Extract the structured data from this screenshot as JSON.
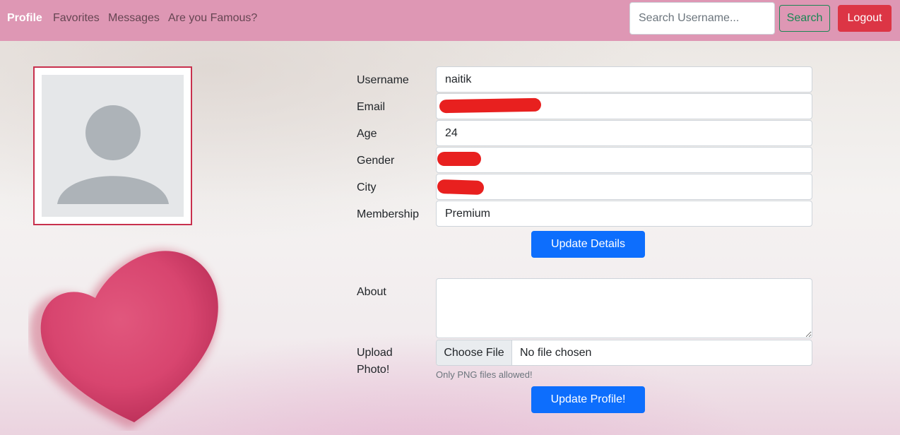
{
  "navbar": {
    "brand": "Profile",
    "links": [
      "Favorites",
      "Messages",
      "Are you Famous?"
    ],
    "search_placeholder": "Search Username...",
    "search_button": "Search",
    "logout_button": "Logout"
  },
  "avatar": {
    "icon": "user-silhouette-icon"
  },
  "decoration": {
    "icon": "heart-icon",
    "color": "#d8456f"
  },
  "form": {
    "username": {
      "label": "Username",
      "value": "naitik"
    },
    "email": {
      "label": "Email",
      "value": ""
    },
    "age": {
      "label": "Age",
      "value": "24"
    },
    "gender": {
      "label": "Gender",
      "value": ""
    },
    "city": {
      "label": "City",
      "value": ""
    },
    "membership": {
      "label": "Membership",
      "value": "Premium"
    },
    "update_details_button": "Update Details",
    "about": {
      "label": "About",
      "value": ""
    },
    "upload": {
      "label_line1": "Upload",
      "label_line2": "Photo!",
      "choose_button": "Choose File",
      "status": "No file chosen",
      "hint": "Only PNG files allowed!"
    },
    "update_profile_button": "Update Profile!"
  },
  "colors": {
    "navbar": "#de97b4",
    "primary": "#0d6efd",
    "danger": "#dc3545",
    "success": "#198754",
    "redaction": "#e8201f"
  }
}
